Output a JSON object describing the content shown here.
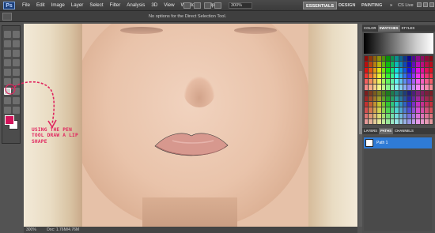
{
  "app": {
    "logo": "Ps"
  },
  "menu": [
    "File",
    "Edit",
    "Image",
    "Layer",
    "Select",
    "Filter",
    "Analysis",
    "3D",
    "View",
    "Window",
    "Help"
  ],
  "menubar": {
    "zoom": "300%",
    "workspaces": [
      "ESSENTIALS",
      "DESIGN",
      "PAINTING"
    ],
    "more": "»",
    "cslive": "CS Live"
  },
  "options": {
    "message": "No options for the Direct Selection Tool."
  },
  "colors": {
    "foreground": "#d2145a",
    "background": "#ffffff",
    "accent": "#2f7bd6",
    "annotation": "#e0245e"
  },
  "annotation": {
    "text": "USING THE PEN TOOL DRAW A LIP SHAPE"
  },
  "status": {
    "zoom": "300%",
    "doc": "Doc: 1.76M/4.76M"
  },
  "panels": {
    "top_tabs": [
      "COLOR",
      "SWATCHES",
      "STYLES"
    ],
    "bottom_tabs": [
      "LAYERS",
      "PATHS",
      "CHANNELS"
    ],
    "paths": [
      {
        "name": "Path 1"
      }
    ]
  },
  "icons": [
    "pen-icon",
    "direct-selection-icon",
    "move-icon",
    "marquee-icon",
    "lasso-icon",
    "quick-select-icon",
    "crop-icon",
    "eyedropper-icon",
    "healing-icon",
    "brush-icon",
    "clone-stamp-icon",
    "history-brush-icon",
    "eraser-icon",
    "gradient-icon",
    "blur-icon",
    "dodge-icon",
    "type-icon",
    "shape-icon",
    "hand-icon",
    "zoom-icon"
  ]
}
